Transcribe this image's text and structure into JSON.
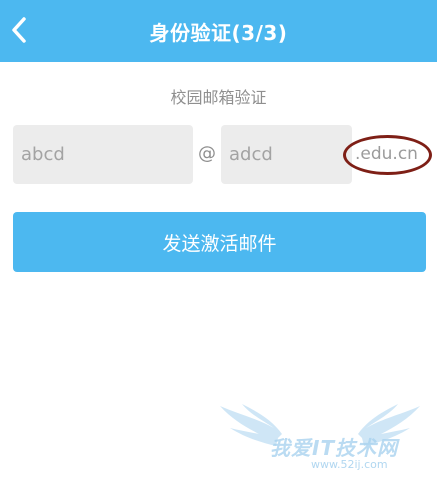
{
  "header": {
    "title": "身份验证(3/3)",
    "back_icon": "chevron-left-icon",
    "background": "#4cb8f0"
  },
  "form": {
    "section_label": "校园邮箱验证",
    "username_placeholder": "abcd",
    "at_sign": "@",
    "domain_placeholder": "adcd",
    "suffix": ".edu.cn",
    "highlight_color": "#7e1f16"
  },
  "send_button": {
    "label": "发送激活邮件",
    "background": "#4cb8f0"
  },
  "watermark": {
    "text": "我爱IT技术网",
    "url": "www.52ij.com"
  }
}
